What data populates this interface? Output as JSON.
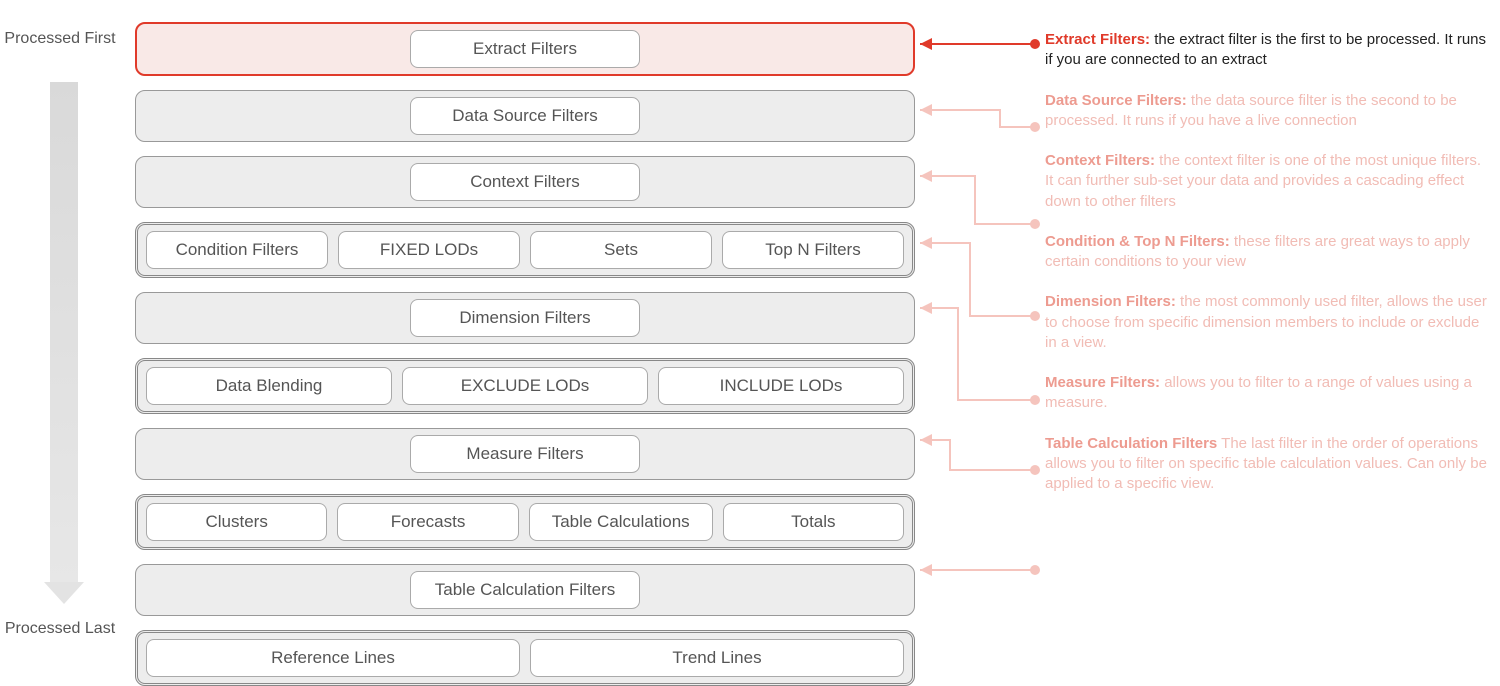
{
  "axis": {
    "top": "Processed First",
    "bottom": "Processed Last"
  },
  "rows": [
    {
      "pills": [
        "Extract Filters"
      ],
      "highlight": true
    },
    {
      "pills": [
        "Data Source Filters"
      ]
    },
    {
      "pills": [
        "Context Filters"
      ]
    },
    {
      "pills": [
        "Condition Filters",
        "FIXED LODs",
        "Sets",
        "Top N Filters"
      ],
      "double": true
    },
    {
      "pills": [
        "Dimension Filters"
      ]
    },
    {
      "pills": [
        "Data Blending",
        "EXCLUDE LODs",
        "INCLUDE LODs"
      ],
      "double": true
    },
    {
      "pills": [
        "Measure Filters"
      ]
    },
    {
      "pills": [
        "Clusters",
        "Forecasts",
        "Table Calculations",
        "Totals"
      ],
      "double": true
    },
    {
      "pills": [
        "Table Calculation Filters"
      ]
    },
    {
      "pills": [
        "Reference Lines",
        "Trend Lines"
      ],
      "double": true
    }
  ],
  "notes": [
    {
      "title": "Extract Filters:",
      "desc": " the extract filter is the first to be processed. It runs if you are connected to an extract",
      "active": true
    },
    {
      "title": "Data Source Filters:",
      "desc": " the data source filter is the second to be processed. It runs if you have a live connection"
    },
    {
      "title": "Context Filters:",
      "desc": " the context filter is one of the most unique filters. It can further sub-set your data and provides a cascading effect down to other filters"
    },
    {
      "title": "Condition & Top N Filters:",
      "desc": " these filters are great ways to apply certain conditions to your view"
    },
    {
      "title": "Dimension Filters:",
      "desc": " the most commonly used filter, allows the user to choose from specific dimension members to include or exclude in a view."
    },
    {
      "title": "Measure Filters:",
      "desc": "  allows you to filter to a range of values using a measure."
    },
    {
      "title": "Table Calculation Filters",
      "desc": " The last filter in the order of operations allows you to filter on specific table calculation values. Can only be applied to a specific view."
    }
  ],
  "colors": {
    "accent": "#e03a2a",
    "faded": "#f1bcb5"
  }
}
